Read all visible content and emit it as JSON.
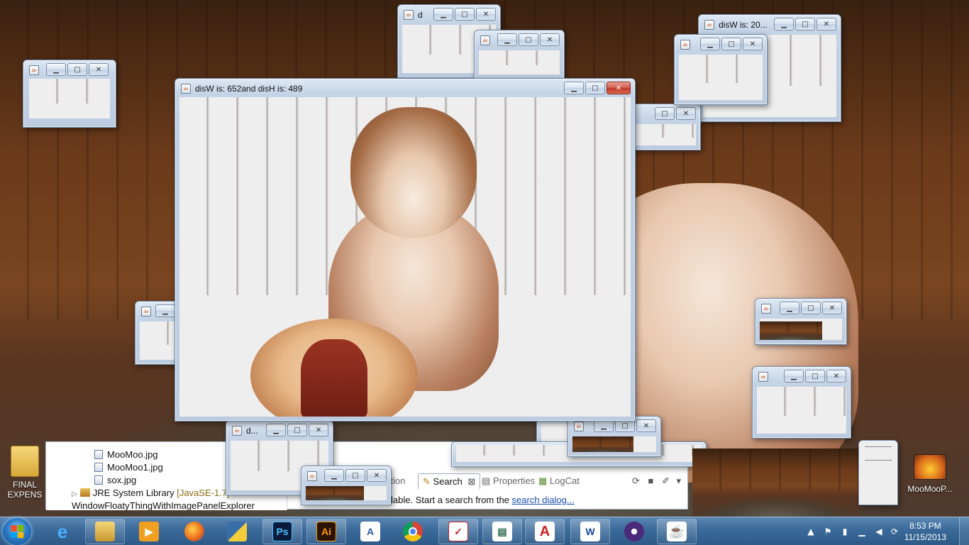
{
  "main_window": {
    "title": "disW is: 652and disH is: 489"
  },
  "small_windows": {
    "w_top_center_title": "d",
    "w_right_top_title": "disW is: 20...",
    "w_bottom_left_title": "d..."
  },
  "eclipse": {
    "package_explorer": {
      "items": [
        "MooMoo.jpg",
        "MooMoo1.jpg",
        "sox.jpg"
      ],
      "jre_label": "JRE System Library",
      "jre_version": "[JavaSE-1.7]",
      "cut_item": "WindowFloatyThingWithImagePanelExplorer"
    },
    "views": {
      "partial_tab": "ration",
      "search_tab": "Search",
      "properties_tab": "Properties",
      "logcat_tab": "LogCat"
    },
    "search_message_prefix": "lable. Start a search from the",
    "search_message_link": "search dialog..."
  },
  "desktop": {
    "left_icon_label_1": "FINAL",
    "left_icon_label_2": "EXPENS",
    "right_icon_label": "MooMooP..."
  },
  "taskbar": {
    "time": "8:53 PM",
    "date": "11/15/2013",
    "apps": [
      "start",
      "internet-explorer",
      "file-explorer",
      "media-player",
      "firefox",
      "python",
      "photoshop",
      "illustrator",
      "publisher",
      "chrome",
      "presentation-app",
      "slideshow-app",
      "acrobat",
      "word",
      "eclipse",
      "java"
    ]
  }
}
